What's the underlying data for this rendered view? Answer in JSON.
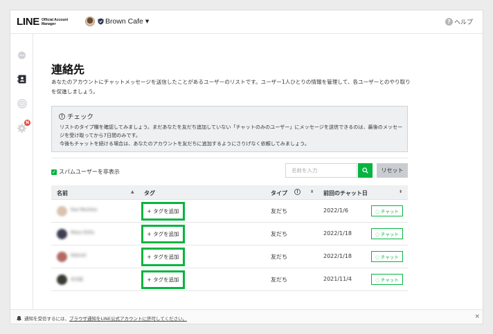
{
  "header": {
    "logo_main": "LINE",
    "logo_sub": "Official Account Manager",
    "account_name": "Brown Cafe",
    "help_label": "ヘルプ"
  },
  "sidebar": {
    "items": [
      {
        "icon": "chat-bubble-icon"
      },
      {
        "icon": "contacts-icon"
      },
      {
        "icon": "broadcast-icon"
      },
      {
        "icon": "settings-gear-icon",
        "badge": "N"
      }
    ]
  },
  "page": {
    "title": "連絡先",
    "description": "あなたのアカウントにチャットメッセージを送信したことがあるユーザーのリストです。ユーザー1人ひとりの情報を管理して、各ユーザーとのやり取りを促進しましょう。"
  },
  "notice": {
    "title": "チェック",
    "lines": [
      "リストのタイプ欄を確認してみましょう。まだあなたを友だち追加していない「チャットのみのユーザー」にメッセージを送信できるのは、最後のメッセージを受け取ってから7日間のみです。",
      "今後もチャットを続ける場合は、あなたのアカウントを友だちに追加するようにさりげなく依頼してみましょう。"
    ]
  },
  "filters": {
    "spam_label": "スパムユーザーを非表示",
    "search_placeholder": "名前を入力",
    "reset_label": "リセット"
  },
  "table": {
    "headers": {
      "name": "名前",
      "tag": "タグ",
      "type": "タイプ",
      "last_chat": "前回のチャット日"
    },
    "rows": [
      {
        "name": "Rae Marshes",
        "tag_button": "+ タグを追加",
        "type": "友だち",
        "last_chat": "2022/1/6",
        "chat_button": "チャット",
        "avatar_color": "#d9c3b0"
      },
      {
        "name": "Mesa Shilla",
        "tag_button": "+ タグを追加",
        "type": "友だち",
        "last_chat": "2022/1/18",
        "chat_button": "チャット",
        "avatar_color": "#3e3f52"
      },
      {
        "name": "Natsuki",
        "tag_button": "+ タグを追加",
        "type": "友だち",
        "last_chat": "2022/1/18",
        "chat_button": "チャット",
        "avatar_color": "#b26a66"
      },
      {
        "name": "ゆき絵",
        "tag_button": "+ タグを追加",
        "type": "友だち",
        "last_chat": "2021/11/4",
        "chat_button": "チャット",
        "avatar_color": "#3a3a32"
      }
    ]
  },
  "footer": {
    "text_prefix": "通知を受信するには、",
    "link_text": "ブラウザ通知をLINE公式アカウントに許可してください。",
    "close_symbol": "×"
  },
  "colors": {
    "accent_green": "#06b43f",
    "badge_red": "#e2453c"
  }
}
